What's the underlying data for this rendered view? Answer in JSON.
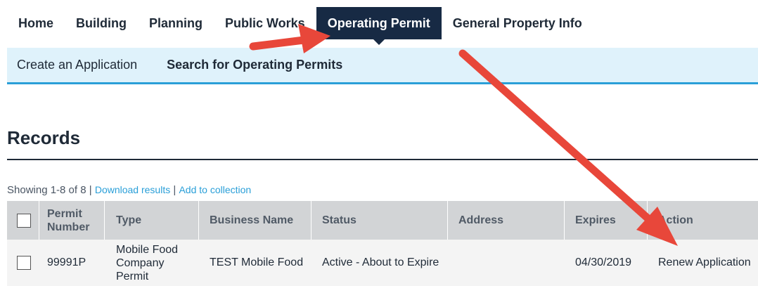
{
  "topnav": {
    "tabs": [
      {
        "label": "Home"
      },
      {
        "label": "Building"
      },
      {
        "label": "Planning"
      },
      {
        "label": "Public Works"
      },
      {
        "label": "Operating Permit",
        "active": true
      },
      {
        "label": "General Property Info"
      }
    ]
  },
  "subnav": {
    "create": "Create an Application",
    "search": "Search for Operating Permits"
  },
  "records": {
    "heading": "Records",
    "showing": "Showing 1-8 of 8",
    "sep": "|",
    "download": "Download results",
    "add": "Add to collection"
  },
  "table": {
    "columns": {
      "permit": "Permit Number",
      "type": "Type",
      "business": "Business Name",
      "status": "Status",
      "address": "Address",
      "expires": "Expires",
      "action": "Action"
    },
    "rows": [
      {
        "permit": "99991P",
        "type": "Mobile Food Company Permit",
        "business": "TEST Mobile Food",
        "status": "Active - About to Expire",
        "address": "",
        "expires": "04/30/2019",
        "action": "Renew Application"
      }
    ]
  },
  "colors": {
    "accent": "#2a9fd8",
    "nav_active": "#172a44",
    "annotation_arrow": "#e8473a"
  }
}
